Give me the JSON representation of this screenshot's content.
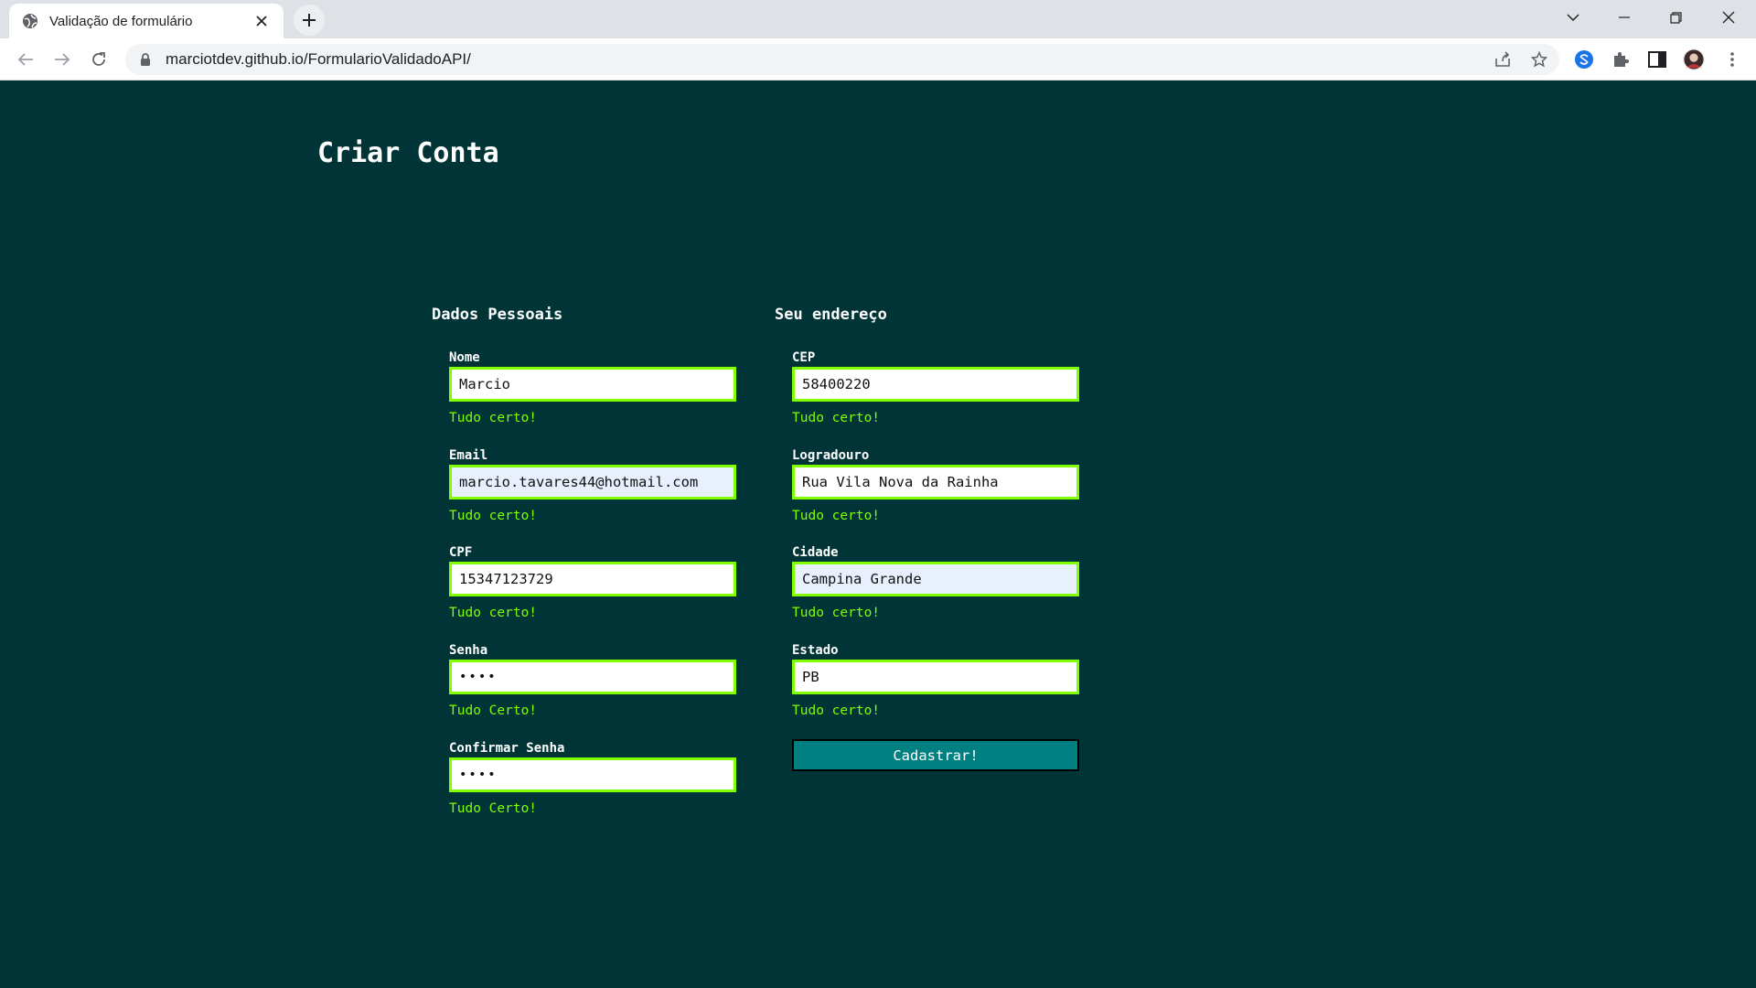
{
  "browser": {
    "tab_title": "Validação de formulário",
    "url": "marciotdev.github.io/FormularioValidadoAPI/"
  },
  "page": {
    "title": "Criar Conta",
    "section_personal": "Dados Pessoais",
    "section_address": "Seu endereço",
    "submit_label": "Cadastrar!"
  },
  "fields": {
    "nome": {
      "label": "Nome",
      "value": "Marcio",
      "message": "Tudo certo!"
    },
    "email": {
      "label": "Email",
      "value": "marcio.tavares44@hotmail.com",
      "message": "Tudo certo!"
    },
    "cpf": {
      "label": "CPF",
      "value": "15347123729",
      "message": "Tudo certo!"
    },
    "senha": {
      "label": "Senha",
      "value": "••••",
      "message": "Tudo Certo!"
    },
    "confirmar_senha": {
      "label": "Confirmar Senha",
      "value": "••••",
      "message": "Tudo Certo!"
    },
    "cep": {
      "label": "CEP",
      "value": "58400220",
      "message": "Tudo certo!"
    },
    "logradouro": {
      "label": "Logradouro",
      "value": "Rua Vila Nova da Rainha",
      "message": "Tudo certo!"
    },
    "cidade": {
      "label": "Cidade",
      "value": "Campina Grande",
      "message": "Tudo certo!"
    },
    "estado": {
      "label": "Estado",
      "value": "PB",
      "message": "Tudo certo!"
    }
  },
  "colors": {
    "background": "#003436",
    "valid": "#7fff00",
    "button": "#008080"
  }
}
